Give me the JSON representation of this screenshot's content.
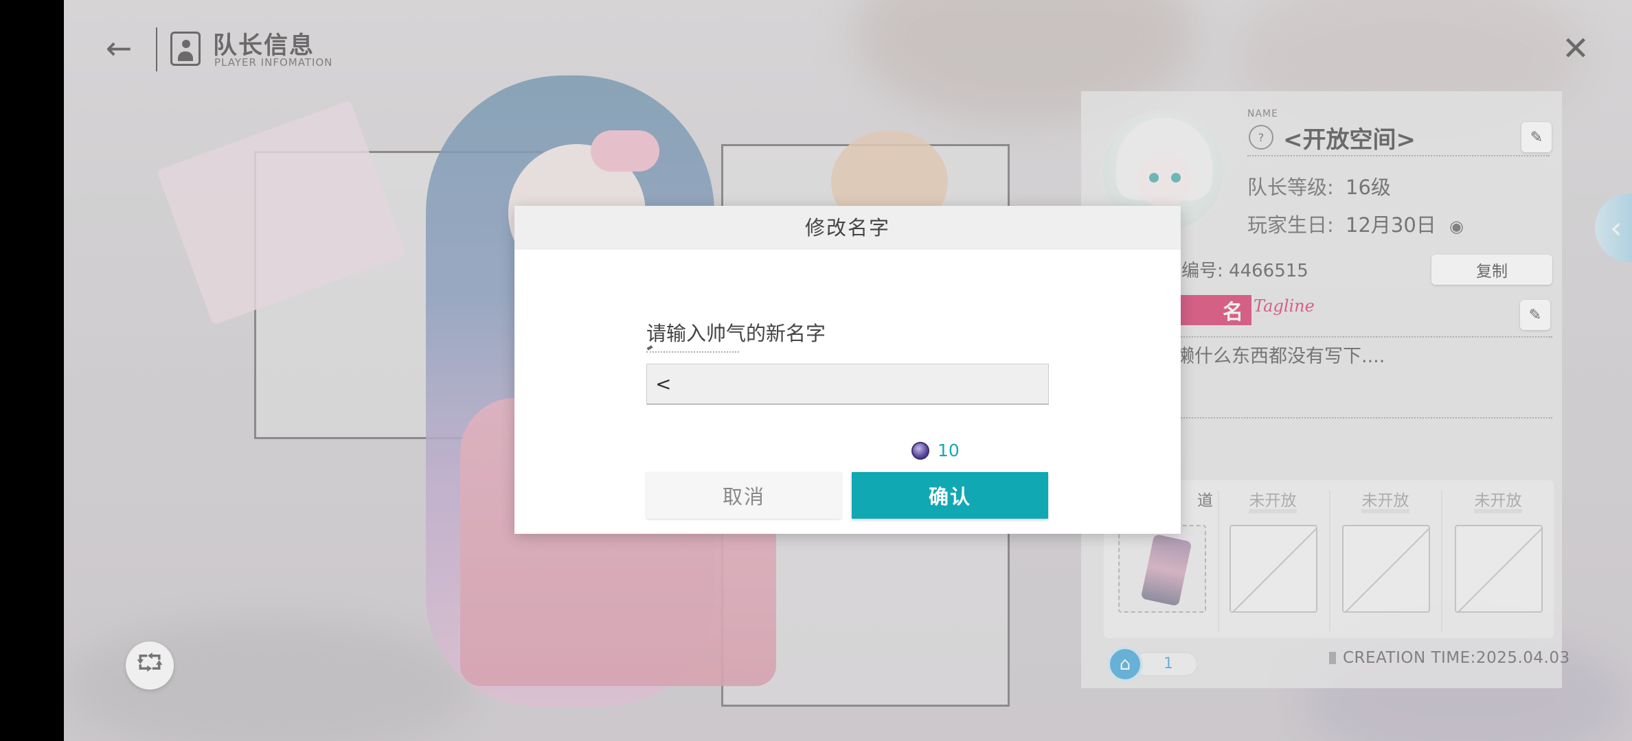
{
  "header": {
    "title": "队长信息",
    "subtitle": "PLAYER INFOMATION",
    "back_icon": "arrow-left-icon",
    "close_icon": "close-icon"
  },
  "profile": {
    "name_label": "NAME",
    "player_name": "<开放空间>",
    "level_label": "队长等级:",
    "level_value": "16级",
    "birthday_label": "玩家生日:",
    "birthday_value": "12月30日",
    "player_id": "编号: 4466515",
    "copy_label": "复制",
    "signature_tag": "名",
    "tagline": "Tagline",
    "signature_text": "懒什么东西都没有写下....",
    "slots": [
      {
        "label": "道"
      },
      {
        "label": "未开放"
      },
      {
        "label": "未开放"
      },
      {
        "label": "未开放"
      }
    ],
    "like_count": "1",
    "creation_time": "CREATION TIME:2025.04.03"
  },
  "modal": {
    "title": "修改名字",
    "prompt": "请输入帅气的新名字",
    "input_value": "<",
    "cost_value": "10",
    "cancel_label": "取消",
    "confirm_label": "确认"
  },
  "colors": {
    "accent_teal": "#10a8b3",
    "signature_red": "#d6245f",
    "like_blue": "#2f9fd9"
  }
}
